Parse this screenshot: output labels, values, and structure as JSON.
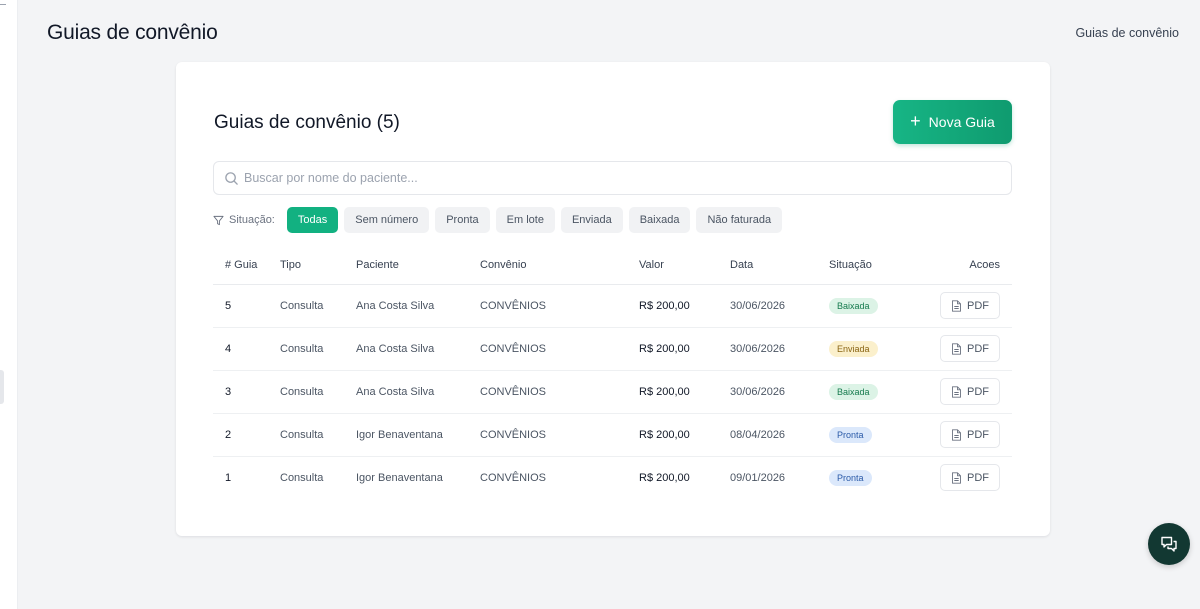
{
  "header": {
    "title": "Guias de convênio",
    "breadcrumb": "Guias de convênio"
  },
  "card": {
    "title": "Guias de convênio (5)",
    "new_button_label": "Nova Guia"
  },
  "search": {
    "placeholder": "Buscar por nome do paciente...",
    "value": ""
  },
  "filters": {
    "label": "Situação:",
    "chips": [
      "Todas",
      "Sem número",
      "Pronta",
      "Em lote",
      "Enviada",
      "Baixada",
      "Não faturada"
    ],
    "active": "Todas"
  },
  "table": {
    "columns": [
      "# Guia",
      "Tipo",
      "Paciente",
      "Convênio",
      "Valor",
      "Data",
      "Situação",
      "Acoes"
    ],
    "rows": [
      {
        "num": "5",
        "tipo": "Consulta",
        "paciente": "Ana Costa Silva",
        "convenio": "CONVÊNIOS",
        "valor": "R$ 200,00",
        "data": "30/06/2026",
        "situacao": "Baixada",
        "acao": "PDF"
      },
      {
        "num": "4",
        "tipo": "Consulta",
        "paciente": "Ana Costa Silva",
        "convenio": "CONVÊNIOS",
        "valor": "R$ 200,00",
        "data": "30/06/2026",
        "situacao": "Enviada",
        "acao": "PDF"
      },
      {
        "num": "3",
        "tipo": "Consulta",
        "paciente": "Ana Costa Silva",
        "convenio": "CONVÊNIOS",
        "valor": "R$ 200,00",
        "data": "30/06/2026",
        "situacao": "Baixada",
        "acao": "PDF"
      },
      {
        "num": "2",
        "tipo": "Consulta",
        "paciente": "Igor Benaventana",
        "convenio": "CONVÊNIOS",
        "valor": "R$ 200,00",
        "data": "08/04/2026",
        "situacao": "Pronta",
        "acao": "PDF"
      },
      {
        "num": "1",
        "tipo": "Consulta",
        "paciente": "Igor Benaventana",
        "convenio": "CONVÊNIOS",
        "valor": "R$ 200,00",
        "data": "09/01/2026",
        "situacao": "Pronta",
        "acao": "PDF"
      }
    ]
  },
  "status_colors": {
    "Baixada": "green",
    "Enviada": "yellow",
    "Pronta": "blue"
  },
  "colors": {
    "accent": "#12b181",
    "fab": "#123832"
  },
  "icons": {
    "search": "search-icon",
    "filter": "filter-icon",
    "plus": "plus-icon",
    "pdf": "file-icon",
    "chat": "chat-icon"
  }
}
